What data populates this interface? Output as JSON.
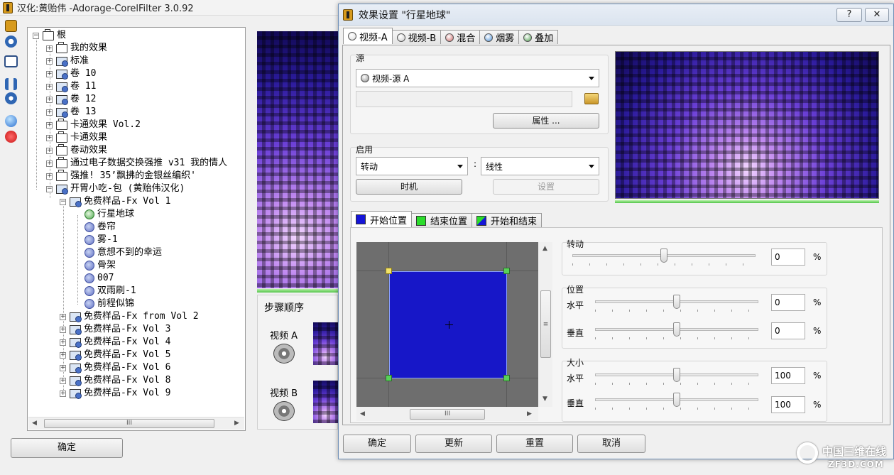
{
  "main_window": {
    "title": "汉化:黄贻伟 -Adorage-CorelFilter 3.0.92",
    "ok_button": "确定"
  },
  "tree": {
    "root": "根",
    "level1": [
      "我的效果",
      "标准",
      "卷 10",
      "卷 11",
      "卷 12",
      "卷 13",
      "卡通效果 Vol.2",
      "卡通效果",
      "卷动效果",
      "通过电子数据交换强推 v31 我的情人",
      "强推! 35’飘拂的金银丝编织'",
      "开胃小吃-包 (黄贻伟汉化)"
    ],
    "group_open": "免费样品-Fx Vol 1",
    "leaves": [
      "行星地球",
      "卷帘",
      "雾-1",
      "意想不到的幸运",
      "骨架",
      "007",
      "双雨刷-1",
      "前程似锦"
    ],
    "level2_rest": [
      "免费样品-Fx from Vol 2",
      "免费样品-Fx Vol 3",
      "免费样品-Fx Vol 4",
      "免费样品-Fx Vol 5",
      "免费样品-Fx Vol 6",
      "免费样品-Fx Vol 8",
      "免费样品-Fx Vol 9"
    ]
  },
  "steps": {
    "title": "步骤顺序",
    "video_a": "视频 A",
    "video_b": "视频 B"
  },
  "dialog": {
    "title": "效果设置 \"行星地球\"",
    "help": "?",
    "close": "✕",
    "tabs": [
      "视频-A",
      "视频-B",
      "混合",
      "烟雾",
      "叠加"
    ],
    "source": {
      "group_label": "源",
      "selected": "视频-源 A",
      "path": "",
      "properties_button": "属性 ..."
    },
    "enable": {
      "group_label": "启用",
      "mode": "转动",
      "curve": "线性",
      "separator": ":",
      "timing_button": "时机",
      "settings_button": "设置"
    },
    "pos_tabs": [
      "开始位置",
      "结束位置",
      "开始和结束"
    ],
    "rotate": {
      "label": "转动",
      "value": "0",
      "unit": "%",
      "level": 0.5
    },
    "position": {
      "label": "位置",
      "h_label": "水平",
      "h_value": "0",
      "h_level": 0.5,
      "v_label": "垂直",
      "v_value": "0",
      "v_level": 0.5,
      "unit": "%"
    },
    "size": {
      "label": "大小",
      "h_label": "水平",
      "h_value": "100",
      "h_level": 0.5,
      "v_label": "垂直",
      "v_value": "100",
      "v_level": 0.5,
      "unit": "%"
    },
    "buttons": {
      "ok": "确定",
      "update": "更新",
      "reset": "重置",
      "cancel": "取消"
    }
  },
  "watermark": {
    "brand": "中国三维在线",
    "url": "ZF3D.COM"
  },
  "colors": {
    "accent_blue": "#1a1ad0",
    "handle_green": "#58d158",
    "handle_yellow": "#f2e36a"
  }
}
